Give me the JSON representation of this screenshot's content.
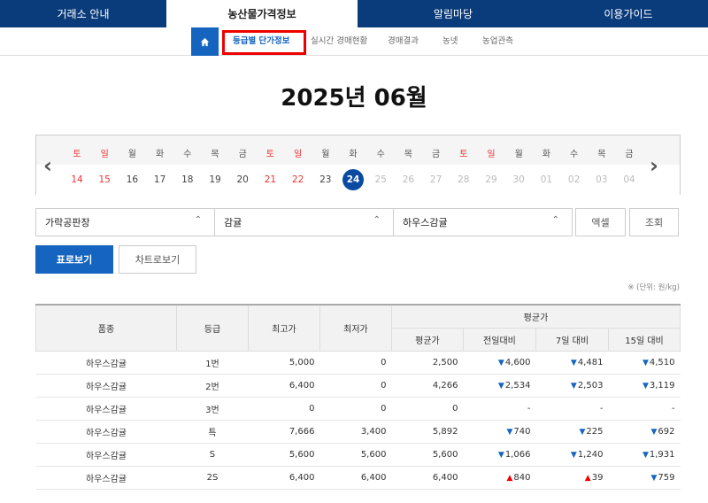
{
  "topnav": {
    "items": [
      "거래소 안내",
      "농산물가격정보",
      "알림마당",
      "이용가이드"
    ]
  },
  "subnav": {
    "items": [
      "등급별 단가정보",
      "실시간 경매현황",
      "경매결과",
      "농넷",
      "농업관측"
    ]
  },
  "title": "2025년 06월",
  "calendar": {
    "days": [
      "토",
      "일",
      "월",
      "화",
      "수",
      "목",
      "금",
      "토",
      "일",
      "월",
      "화",
      "수",
      "목",
      "금",
      "토",
      "일",
      "월",
      "화",
      "수",
      "목",
      "금"
    ],
    "dates": [
      "14",
      "15",
      "16",
      "17",
      "18",
      "19",
      "20",
      "21",
      "22",
      "23",
      "24",
      "25",
      "26",
      "27",
      "28",
      "29",
      "30",
      "01",
      "02",
      "03",
      "04"
    ],
    "selected": "24",
    "prev_icon": "chevron-left-icon",
    "next_icon": "chevron-right-icon"
  },
  "filters": {
    "market": "가락공판장",
    "item": "감귤",
    "variety": "하우스감귤",
    "excel_label": "엑셀",
    "search_label": "조회"
  },
  "view": {
    "table_label": "표로보기",
    "chart_label": "차트로보기"
  },
  "unit_note": "※ (단위: 원/kg)",
  "table": {
    "headers": {
      "variety": "품종",
      "grade": "등급",
      "max": "최고가",
      "min": "최저가",
      "avg_group": "평균가",
      "avg": "평균가",
      "prev_day": "전일대비",
      "week": "7일 대비",
      "fifteen": "15일 대비"
    },
    "rows": [
      {
        "variety": "하우스감귤",
        "grade": "1번",
        "max": "5,000",
        "min": "0",
        "avg": "2,500",
        "d1": "4,600",
        "d1dir": "down",
        "d7": "4,481",
        "d7dir": "down",
        "d15": "4,510",
        "d15dir": "down"
      },
      {
        "variety": "하우스감귤",
        "grade": "2번",
        "max": "6,400",
        "min": "0",
        "avg": "4,266",
        "d1": "2,534",
        "d1dir": "down",
        "d7": "2,503",
        "d7dir": "down",
        "d15": "3,119",
        "d15dir": "down"
      },
      {
        "variety": "하우스감귤",
        "grade": "3번",
        "max": "0",
        "min": "0",
        "avg": "0",
        "d1": "-",
        "d1dir": "none",
        "d7": "-",
        "d7dir": "none",
        "d15": "-",
        "d15dir": "none"
      },
      {
        "variety": "하우스감귤",
        "grade": "특",
        "max": "7,666",
        "min": "3,400",
        "avg": "5,892",
        "d1": "740",
        "d1dir": "down",
        "d7": "225",
        "d7dir": "down",
        "d15": "692",
        "d15dir": "down"
      },
      {
        "variety": "하우스감귤",
        "grade": "S",
        "max": "5,600",
        "min": "5,600",
        "avg": "5,600",
        "d1": "1,066",
        "d1dir": "down",
        "d7": "1,240",
        "d7dir": "down",
        "d15": "1,931",
        "d15dir": "down"
      },
      {
        "variety": "하우스감귤",
        "grade": "2S",
        "max": "6,400",
        "min": "6,400",
        "avg": "6,400",
        "d1": "840",
        "d1dir": "up",
        "d7": "39",
        "d7dir": "up",
        "d15": "759",
        "d15dir": "down"
      }
    ]
  },
  "colors": {
    "nav": "#0a3b7a",
    "accent": "#1565c0",
    "weekend": "#e33",
    "highlight_box": "#e00"
  }
}
